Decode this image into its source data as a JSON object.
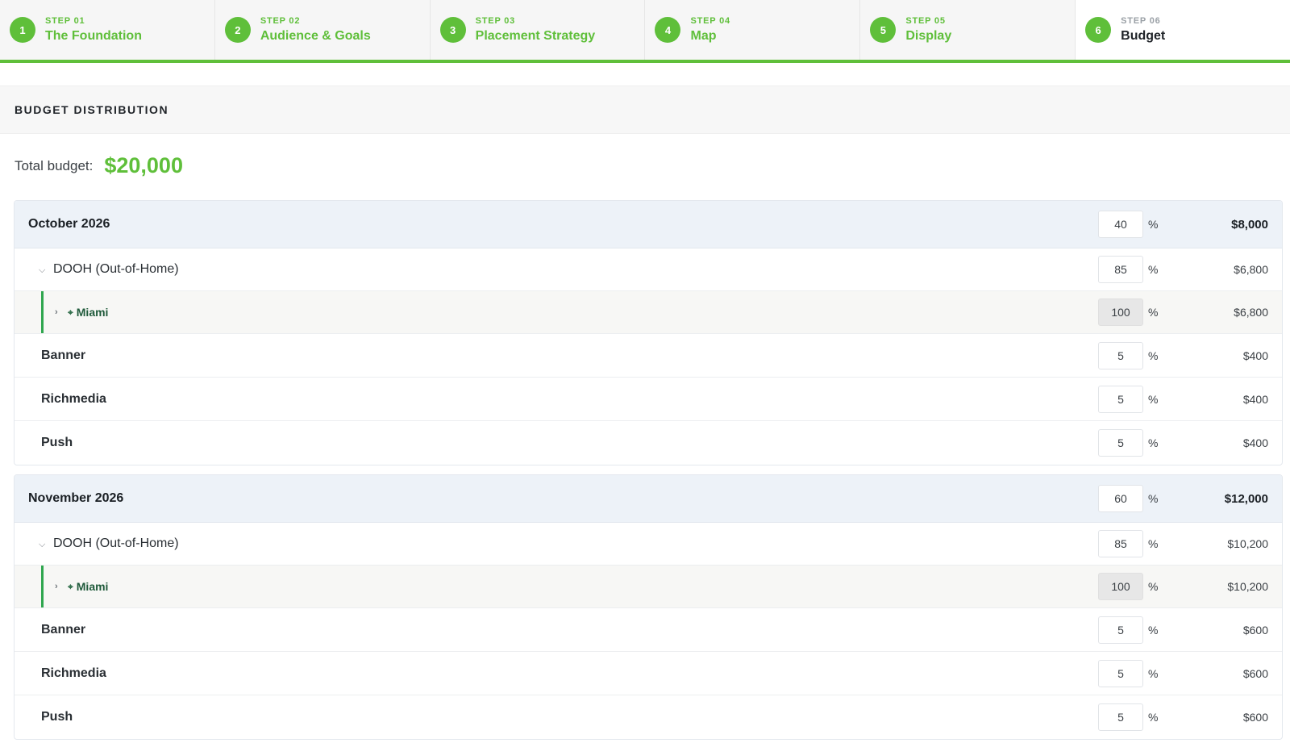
{
  "steps": [
    {
      "number": "1",
      "kicker": "STEP 01",
      "title": "The Foundation"
    },
    {
      "number": "2",
      "kicker": "STEP 02",
      "title": "Audience & Goals"
    },
    {
      "number": "3",
      "kicker": "STEP 03",
      "title": "Placement Strategy"
    },
    {
      "number": "4",
      "kicker": "STEP 04",
      "title": "Map"
    },
    {
      "number": "5",
      "kicker": "STEP 05",
      "title": "Display"
    },
    {
      "number": "6",
      "kicker": "STEP 06",
      "title": "Budget"
    }
  ],
  "colors": {
    "accent": "#5fbf3a",
    "month_header_bg": "#edf2f8",
    "sub_bar": "#2fa64e"
  },
  "section": {
    "title": "BUDGET DISTRIBUTION"
  },
  "total": {
    "label": "Total budget:",
    "value": "$20,000"
  },
  "months": [
    {
      "name": "October 2026",
      "pct": "40",
      "pct_sign": "%",
      "amount": "$8,000",
      "category": {
        "chevron": "⌵",
        "name": "DOOH (Out-of-Home)",
        "pct": "85",
        "pct_sign": "%",
        "amount": "$6,800"
      },
      "location": {
        "chevron": "›",
        "pin": "⌖",
        "name": "Miami",
        "pct": "100",
        "pct_sign": "%",
        "amount": "$6,800"
      },
      "formats": [
        {
          "name": "Banner",
          "pct": "5",
          "pct_sign": "%",
          "amount": "$400"
        },
        {
          "name": "Richmedia",
          "pct": "5",
          "pct_sign": "%",
          "amount": "$400"
        },
        {
          "name": "Push",
          "pct": "5",
          "pct_sign": "%",
          "amount": "$400"
        }
      ]
    },
    {
      "name": "November 2026",
      "pct": "60",
      "pct_sign": "%",
      "amount": "$12,000",
      "category": {
        "chevron": "⌵",
        "name": "DOOH (Out-of-Home)",
        "pct": "85",
        "pct_sign": "%",
        "amount": "$10,200"
      },
      "location": {
        "chevron": "›",
        "pin": "⌖",
        "name": "Miami",
        "pct": "100",
        "pct_sign": "%",
        "amount": "$10,200"
      },
      "formats": [
        {
          "name": "Banner",
          "pct": "5",
          "pct_sign": "%",
          "amount": "$600"
        },
        {
          "name": "Richmedia",
          "pct": "5",
          "pct_sign": "%",
          "amount": "$600"
        },
        {
          "name": "Push",
          "pct": "5",
          "pct_sign": "%",
          "amount": "$600"
        }
      ]
    }
  ]
}
